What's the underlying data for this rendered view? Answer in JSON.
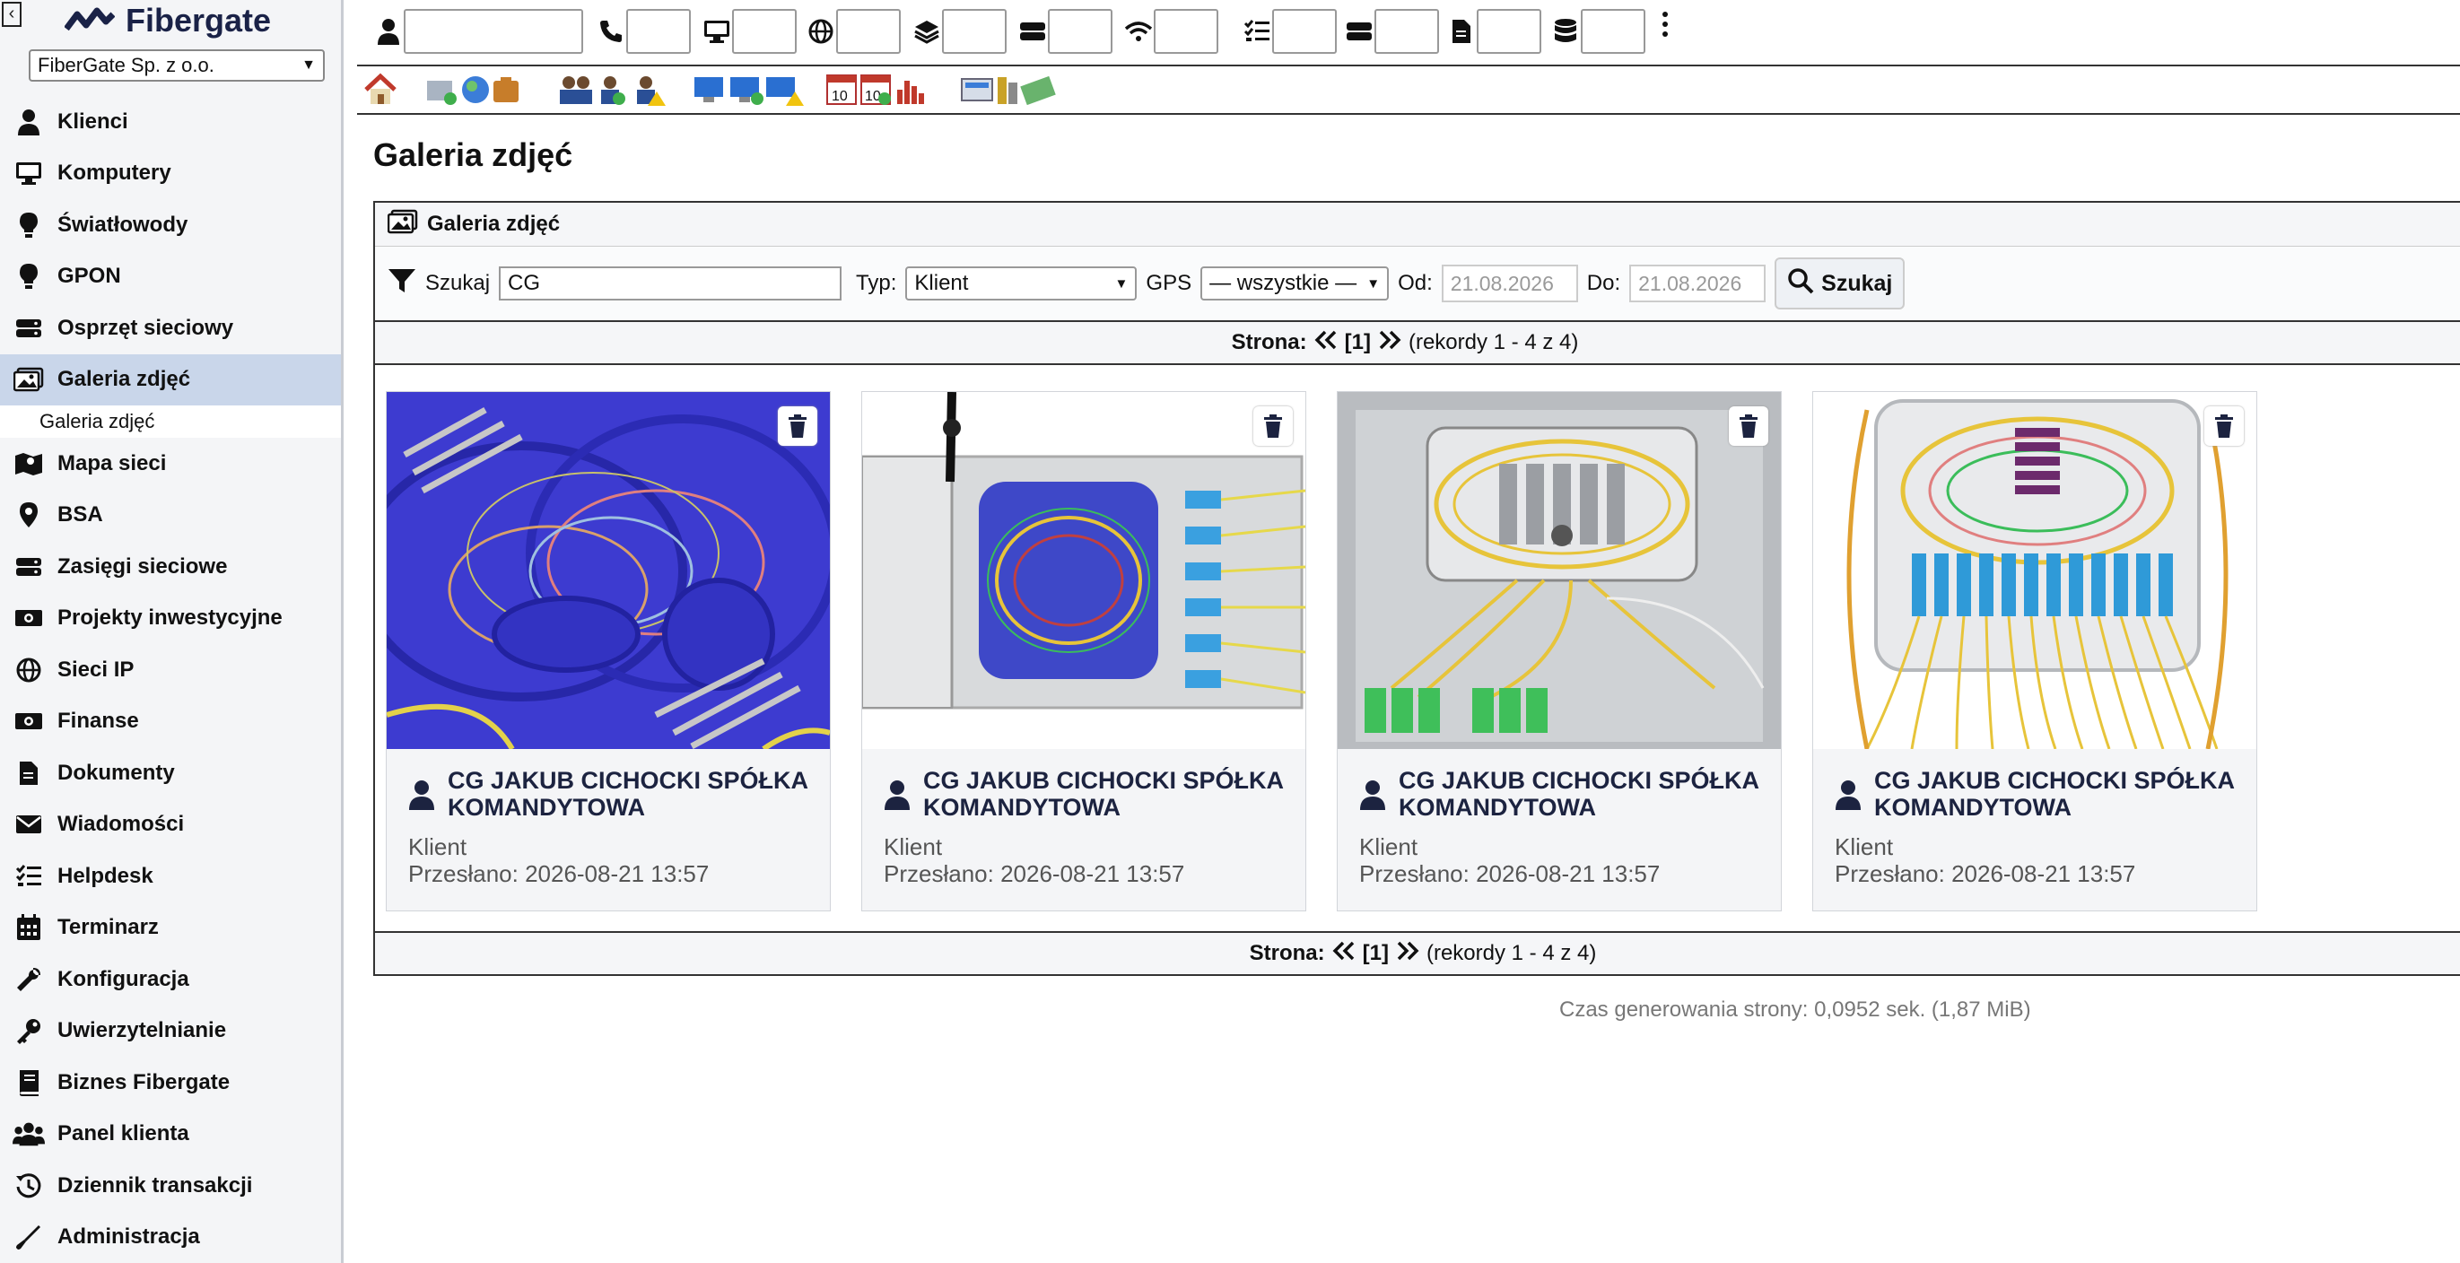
{
  "sidebar": {
    "brand": "Fibergate",
    "company_select": "FiberGate Sp. z o.o.",
    "items": [
      {
        "label": "Klienci",
        "icon": "user-icon"
      },
      {
        "label": "Komputery",
        "icon": "monitor-icon"
      },
      {
        "label": "Światłowody",
        "icon": "bulb-icon"
      },
      {
        "label": "GPON",
        "icon": "bulb-icon"
      },
      {
        "label": "Osprzęt sieciowy",
        "icon": "hdd-icon"
      },
      {
        "label": "Galeria zdjęć",
        "icon": "image-icon",
        "active": true
      },
      {
        "label": "Mapa sieci",
        "icon": "map-icon"
      },
      {
        "label": "BSA",
        "icon": "pin-icon"
      },
      {
        "label": "Zasięgi sieciowe",
        "icon": "hdd-icon"
      },
      {
        "label": "Projekty inwestycyjne",
        "icon": "money-icon"
      },
      {
        "label": "Sieci IP",
        "icon": "globe-icon"
      },
      {
        "label": "Finanse",
        "icon": "money-icon"
      },
      {
        "label": "Dokumenty",
        "icon": "document-icon"
      },
      {
        "label": "Wiadomości",
        "icon": "envelope-icon"
      },
      {
        "label": "Helpdesk",
        "icon": "list-icon"
      },
      {
        "label": "Terminarz",
        "icon": "calendar-icon"
      },
      {
        "label": "Konfiguracja",
        "icon": "wrench-icon"
      },
      {
        "label": "Uwierzytelnianie",
        "icon": "key-icon"
      },
      {
        "label": "Biznes Fibergate",
        "icon": "book-icon"
      },
      {
        "label": "Panel klienta",
        "icon": "users-icon"
      },
      {
        "label": "Dziennik transakcji",
        "icon": "history-icon"
      },
      {
        "label": "Administracja",
        "icon": "tools-icon"
      }
    ],
    "submenu": {
      "label": "Galeria zdjęć"
    }
  },
  "page": {
    "title": "Galeria zdjęć",
    "panel_title": "Galeria zdjęć"
  },
  "filter": {
    "search_label": "Szukaj",
    "search_value": "CG",
    "type_label": "Typ:",
    "type_value": "Klient",
    "gps_label": "GPS",
    "gps_value": "— wszystkie —",
    "from_label": "Od:",
    "from_value": "21.08.2026",
    "to_label": "Do:",
    "to_value": "21.08.2026",
    "search_button": "Szukaj"
  },
  "pager": {
    "label": "Strona:",
    "current": "[1]",
    "records": "(rekordy 1 - 4 z 4)"
  },
  "cards": [
    {
      "owner": "CG JAKUB CICHOCKI SPÓŁKA KOMANDYTOWA",
      "type": "Klient",
      "uploaded": "Przesłano: 2026-08-21 13:57"
    },
    {
      "owner": "CG JAKUB CICHOCKI SPÓŁKA KOMANDYTOWA",
      "type": "Klient",
      "uploaded": "Przesłano: 2026-08-21 13:57"
    },
    {
      "owner": "CG JAKUB CICHOCKI SPÓŁKA KOMANDYTOWA",
      "type": "Klient",
      "uploaded": "Przesłano: 2026-08-21 13:57"
    },
    {
      "owner": "CG JAKUB CICHOCKI SPÓŁKA KOMANDYTOWA",
      "type": "Klient",
      "uploaded": "Przesłano: 2026-08-21 13:57"
    }
  ],
  "footer": {
    "generation_time": "Czas generowania strony: 0,0952 sek. (1,87 MiB)"
  },
  "colors": {
    "accent": "#1a2247",
    "active_menu_bg": "#c9d6ea"
  }
}
